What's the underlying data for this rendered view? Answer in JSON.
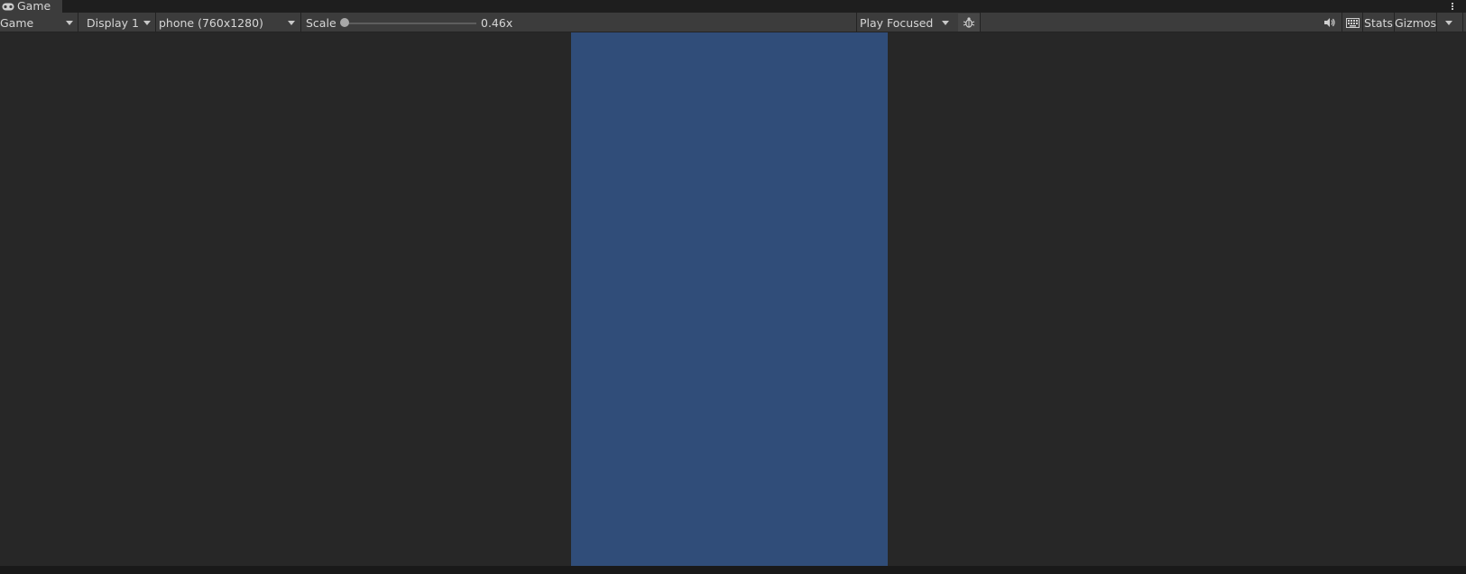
{
  "tab": {
    "title": "Game",
    "icon": "gamepad-icon"
  },
  "toolbar": {
    "view_mode": "Game",
    "display": "Display 1",
    "resolution": "phone (760x1280)",
    "scale_label": "Scale",
    "scale_value": "0.46x",
    "play_mode": "Play Focused",
    "stats_label": "Stats",
    "gizmos_label": "Gizmos"
  },
  "icons": {
    "tab": "gamepad-icon",
    "menu": "kebab-menu-icon",
    "bug": "bug-icon",
    "audio": "speaker-icon",
    "shortcuts": "keyboard-icon"
  },
  "colors": {
    "game_background": "#304d79",
    "viewport_background": "#272727",
    "toolbar_background": "#3c3c3c"
  }
}
